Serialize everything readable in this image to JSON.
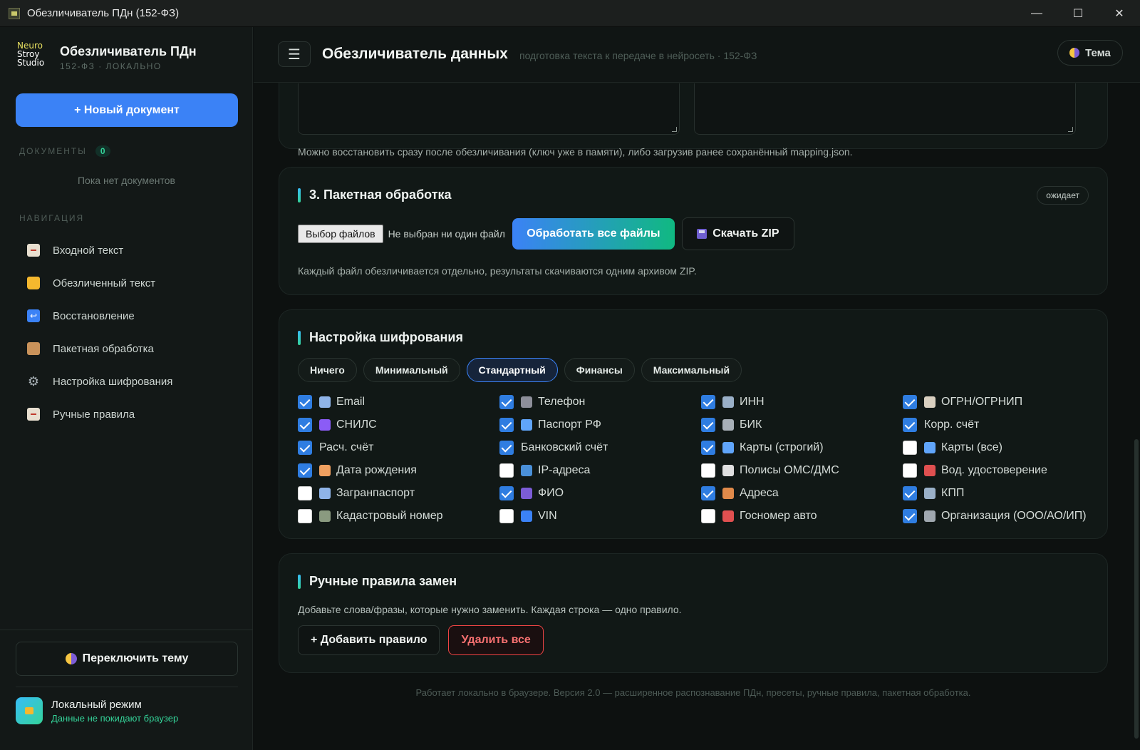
{
  "window": {
    "title": "Обезличиватель ПДн (152-ФЗ)",
    "minimize": "—",
    "maximize": "☐",
    "close": "✕"
  },
  "sidebar": {
    "logo_lines": [
      "Neuro",
      "Stroy",
      "Studio"
    ],
    "brand_title": "Обезличиватель ПДн",
    "brand_sub": "152-ФЗ · ЛОКАЛЬНО",
    "new_doc": "+ Новый документ",
    "docs_label": "ДОКУМЕНТЫ",
    "docs_count": "0",
    "docs_empty": "Пока нет документов",
    "nav_label": "НАВИГАЦИЯ",
    "nav": [
      {
        "label": "Входной текст",
        "icon": "document-icon",
        "color": "#e8dfd0"
      },
      {
        "label": "Обезличенный текст",
        "icon": "lock-icon",
        "color": "#f5b82e"
      },
      {
        "label": "Восстановление",
        "icon": "return-arrow-icon",
        "color": "#3b82f6"
      },
      {
        "label": "Пакетная обработка",
        "icon": "package-icon",
        "color": "#c9925a"
      },
      {
        "label": "Настройка шифрования",
        "icon": "gear-icon",
        "color": "#9aa3a8"
      },
      {
        "label": "Ручные правила",
        "icon": "memo-icon",
        "color": "#e8dfd0"
      }
    ],
    "theme_toggle": "Переключить тему",
    "local_title": "Локальный режим",
    "local_sub": "Данные не покидают браузер"
  },
  "header": {
    "menu": "☰",
    "title": "Обезличиватель данных",
    "subtitle": "подготовка текста к передаче в нейросеть · 152-ФЗ",
    "theme": "Тема"
  },
  "restore": {
    "note": "Можно восстановить сразу после обезличивания (ключ уже в памяти), либо загрузив ранее сохранённый mapping.json."
  },
  "batch": {
    "title": "3. Пакетная обработка",
    "status": "ожидает",
    "choose": "Выбор файлов",
    "no_file": "Не выбран ни один файл",
    "process": "Обработать все файлы",
    "zip": "Скачать ZIP",
    "note": "Каждый файл обезличивается отдельно, результаты скачиваются одним архивом ZIP."
  },
  "encryption": {
    "title": "Настройка шифрования",
    "presets": [
      {
        "label": "Ничего",
        "active": false
      },
      {
        "label": "Минимальный",
        "active": false
      },
      {
        "label": "Стандартный",
        "active": true
      },
      {
        "label": "Финансы",
        "active": false
      },
      {
        "label": "Максимальный",
        "active": false
      }
    ],
    "options": [
      {
        "label": "Email",
        "checked": true,
        "icon": "email-icon",
        "color": "#8fb4e8"
      },
      {
        "label": "Телефон",
        "checked": true,
        "icon": "phone-icon",
        "color": "#8d8f9a"
      },
      {
        "label": "ИНН",
        "checked": true,
        "icon": "building-icon",
        "color": "#9ab0c8"
      },
      {
        "label": "ОГРН/ОГРНИП",
        "checked": true,
        "icon": "receipt-icon",
        "color": "#d9d0c0"
      },
      {
        "label": "СНИЛС",
        "checked": true,
        "icon": "id-icon",
        "color": "#8b5cf6"
      },
      {
        "label": "Паспорт РФ",
        "checked": true,
        "icon": "passport-icon",
        "color": "#60a5fa"
      },
      {
        "label": "БИК",
        "checked": true,
        "icon": "bank-icon",
        "color": "#a8b0b8"
      },
      {
        "label": "Корр. счёт",
        "checked": true,
        "icon": "",
        "color": ""
      },
      {
        "label": "Расч. счёт",
        "checked": true,
        "icon": "",
        "color": ""
      },
      {
        "label": "Банковский счёт",
        "checked": true,
        "icon": "",
        "color": ""
      },
      {
        "label": "Карты (строгий)",
        "checked": true,
        "icon": "credit-card-icon",
        "color": "#60a5fa"
      },
      {
        "label": "Карты (все)",
        "checked": false,
        "icon": "credit-card-icon",
        "color": "#60a5fa"
      },
      {
        "label": "Дата рождения",
        "checked": true,
        "icon": "cake-icon",
        "color": "#f0a060"
      },
      {
        "label": "IP-адреса",
        "checked": false,
        "icon": "globe-icon",
        "color": "#4a90d9"
      },
      {
        "label": "Полисы ОМС/ДМС",
        "checked": false,
        "icon": "page-icon",
        "color": "#e0e0e0"
      },
      {
        "label": "Вод. удостоверение",
        "checked": false,
        "icon": "car-icon",
        "color": "#e05050"
      },
      {
        "label": "Загранпаспорт",
        "checked": false,
        "icon": "airplane-icon",
        "color": "#8fb4e8"
      },
      {
        "label": "ФИО",
        "checked": true,
        "icon": "person-icon",
        "color": "#7c5cd6"
      },
      {
        "label": "Адреса",
        "checked": true,
        "icon": "house-icon",
        "color": "#e08a4a"
      },
      {
        "label": "КПП",
        "checked": true,
        "icon": "office-icon",
        "color": "#9ab0c8"
      },
      {
        "label": "Кадастровый номер",
        "checked": false,
        "icon": "land-icon",
        "color": "#8a9a80"
      },
      {
        "label": "VIN",
        "checked": false,
        "icon": "car-icon",
        "color": "#3b82f6"
      },
      {
        "label": "Госномер авто",
        "checked": false,
        "icon": "car-icon",
        "color": "#e05050"
      },
      {
        "label": "Организация (ООО/АО/ИП)",
        "checked": true,
        "icon": "factory-icon",
        "color": "#a0a8b0"
      }
    ]
  },
  "rules": {
    "title": "Ручные правила замен",
    "note": "Добавьте слова/фразы, которые нужно заменить. Каждая строка — одно правило.",
    "add": "+ Добавить правило",
    "delete_all": "Удалить все"
  },
  "footer": "Работает локально в браузере. Версия 2.0 — расширенное распознавание ПДн, пресеты, ручные правила, пакетная обработка."
}
